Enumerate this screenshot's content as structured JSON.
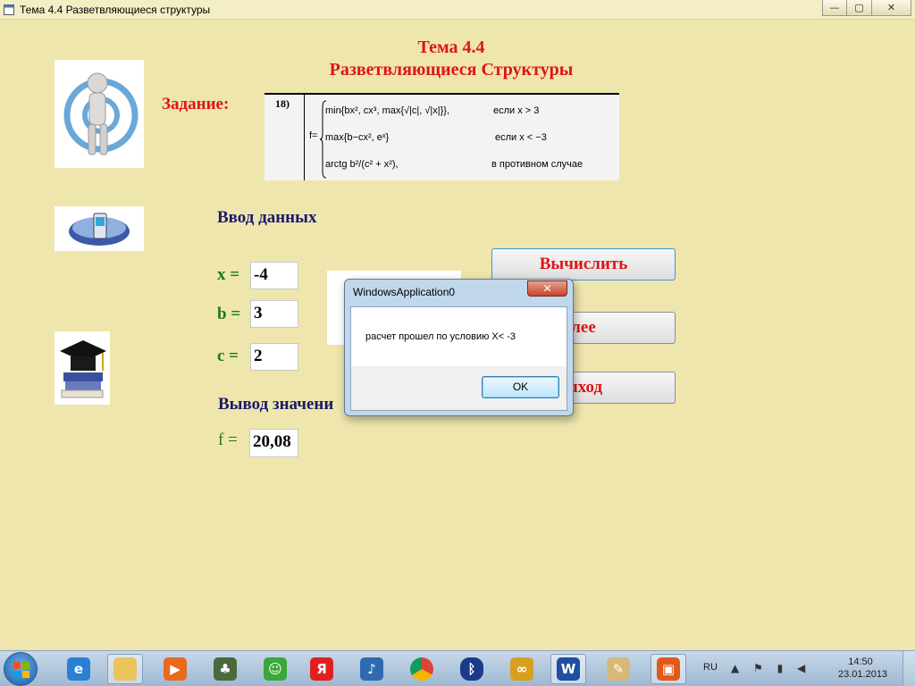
{
  "window": {
    "title": "Тема 4.4 Разветвляющиеся структуры",
    "minimize": "—",
    "maximize": "▢",
    "close": "✕"
  },
  "header": {
    "topic": "Тема 4.4",
    "subtitle": "Разветвляющиеся Структуры",
    "task_label": "Задание:"
  },
  "formula": {
    "number": "18)",
    "f_eq": "f=",
    "rows": [
      {
        "expr": "min{bx², cx³, max{√|c|, √|x|}},",
        "cond": "если x > 3"
      },
      {
        "expr": "max{b−cx², eˣ}",
        "cond": "если x < −3"
      },
      {
        "expr": "arctg b²/(c² + x²),",
        "cond": "в противном случае"
      }
    ]
  },
  "input_section": {
    "title": "Ввод данных",
    "x_label": "x =",
    "x_value": "-4",
    "b_label": "b =",
    "b_value": "3",
    "c_label": "c =",
    "c_value": "2"
  },
  "output_section": {
    "title": "Вывод значени",
    "f_label": "f =",
    "f_value": "20,08"
  },
  "buttons": {
    "calc": "Вычислить",
    "next": "лее",
    "exit": "ыход"
  },
  "message_box": {
    "title": "WindowsApplication0",
    "text": "расчет прошел по условию  X< -3",
    "ok": "OK",
    "close": "✕"
  },
  "taskbar": {
    "lang": "RU",
    "time": "14:50",
    "date": "23.01.2013",
    "apps": [
      "internet-explorer",
      "file-explorer",
      "media-player",
      "games",
      "messenger",
      "yandex",
      "volume-app",
      "chrome",
      "bluetooth",
      "remote-app",
      "word",
      "paint",
      "office"
    ],
    "yandex_glyph": "Я",
    "word_glyph": "W"
  },
  "colors": {
    "background": "#efe6ad",
    "accent_red": "#e01414",
    "navy": "#1a1a6e",
    "green": "#1a7a1a"
  }
}
